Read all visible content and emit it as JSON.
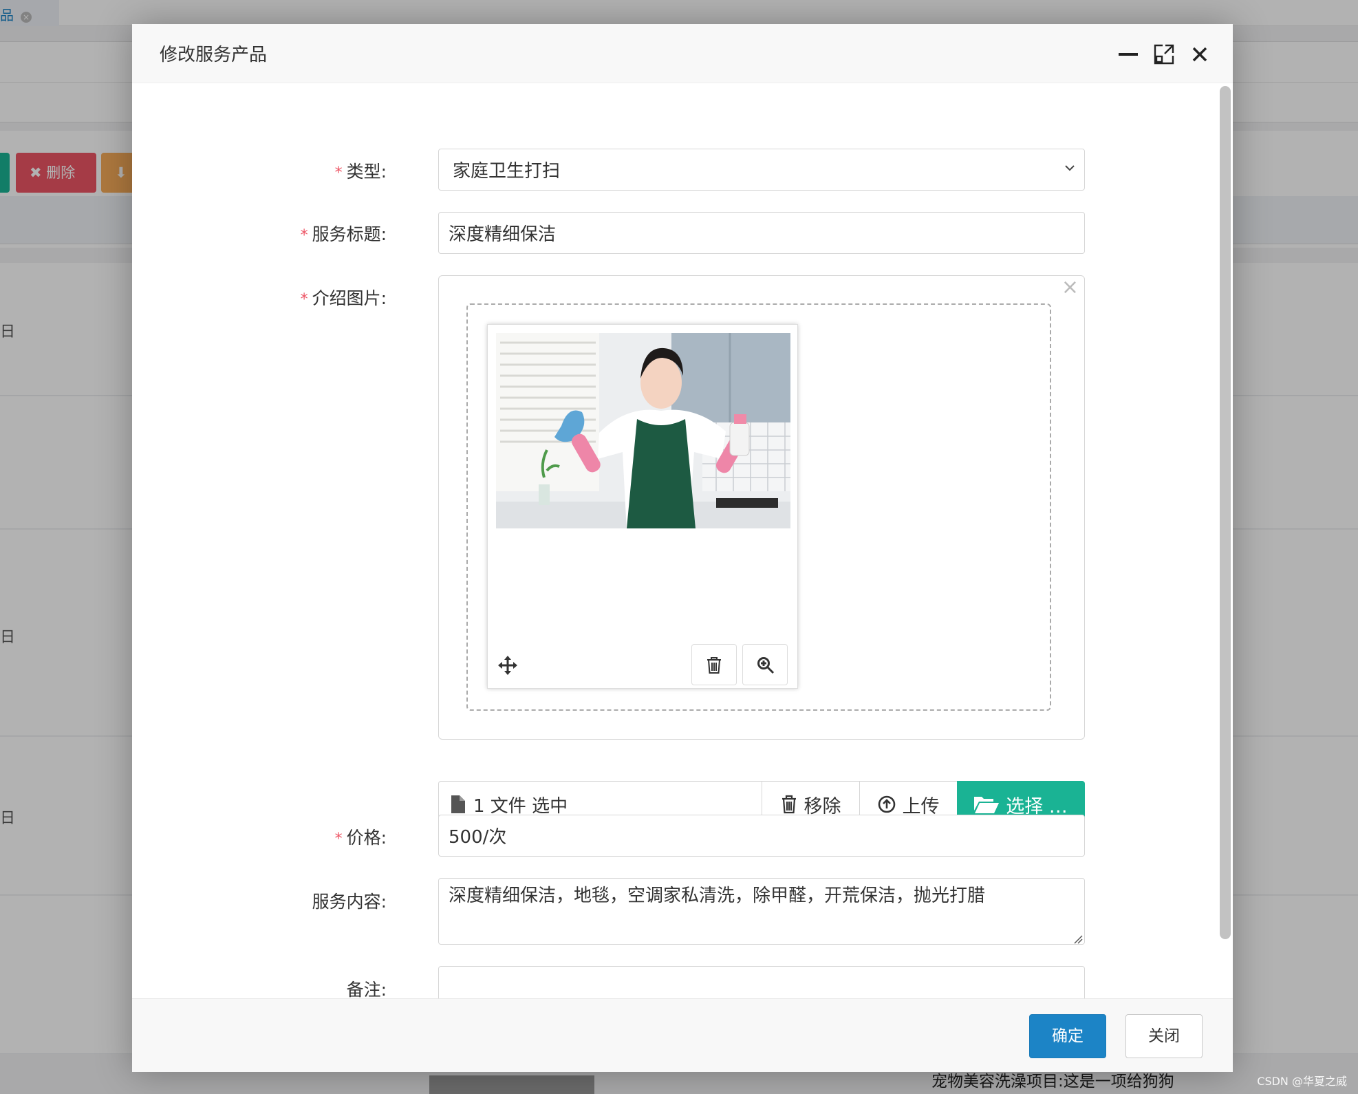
{
  "background": {
    "tab_label": "品",
    "delete_button": "删除",
    "row_date_fragment": "日",
    "bottom_text": "宠物美容洗澡项目:这是一项给狗狗",
    "watermark": "CSDN @华夏之威"
  },
  "dialog": {
    "title": "修改服务产品",
    "controls": {
      "minimize": "minimize-icon",
      "maximize": "maximize-icon",
      "close": "close-icon"
    },
    "form": {
      "type": {
        "label": "类型:",
        "value": "家庭卫生打扫"
      },
      "service_title": {
        "label": "服务标题:",
        "value": "深度精细保洁"
      },
      "intro_image": {
        "label": "介绍图片:",
        "caption": "1 文件 选中",
        "remove_label": "移除",
        "upload_label": "上传",
        "browse_label": "选择 …",
        "close_symbol": "×"
      },
      "price": {
        "label": "价格:",
        "value": "500/次"
      },
      "content": {
        "label": "服务内容:",
        "value": "深度精细保洁，地毯，空调家私清洗，除甲醛，开荒保洁，抛光打腊"
      },
      "remark": {
        "label": "备注:",
        "value": ""
      }
    },
    "footer": {
      "confirm_label": "确定",
      "close_label": "关闭"
    }
  },
  "colors": {
    "primary": "#1c84c6",
    "success": "#1ab394",
    "danger": "#ed5565",
    "warning": "#f8ac59"
  }
}
